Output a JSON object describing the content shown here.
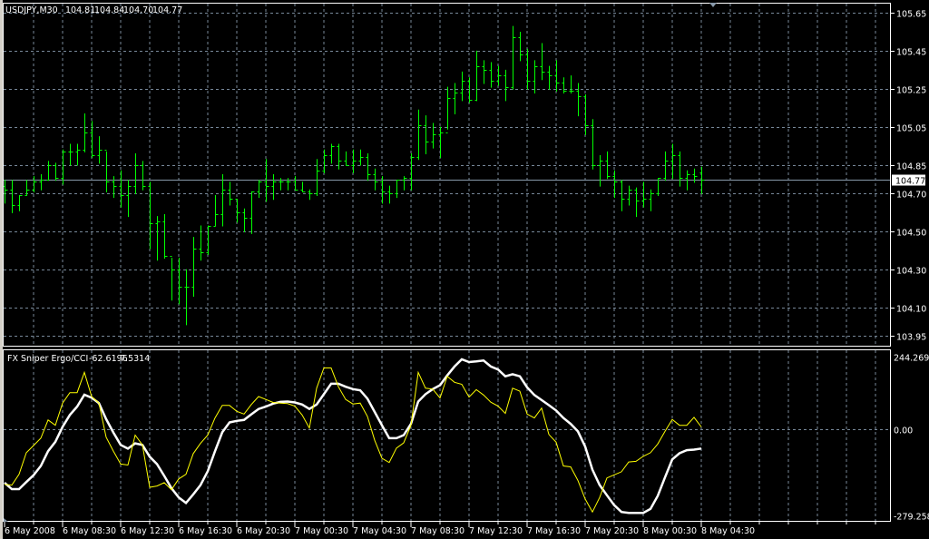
{
  "header": {
    "symbol": "USDJPY,M30",
    "open": "104.81",
    "high": "104.84",
    "low": "104.70",
    "close": "104.77"
  },
  "indicator": {
    "name": "FX Sniper Ergo/CCI",
    "value1": "-62.6196",
    "value2": "7.5314"
  },
  "colors": {
    "background": "#000000",
    "bars": "#00ff00",
    "grid": "#778899",
    "frame": "#ffffff",
    "ergo_line": "#ffffff",
    "cci_line": "#ffff00",
    "price_line": "#8899aa"
  },
  "price_axis": {
    "labels": [
      "105.65",
      "105.45",
      "105.25",
      "105.05",
      "104.85",
      "104.70",
      "104.50",
      "104.30",
      "104.10",
      "103.95"
    ],
    "current_price": "104.77"
  },
  "indicator_axis": {
    "labels": [
      "244.269",
      "0.00",
      "-279.258"
    ]
  },
  "time_axis": {
    "labels": [
      "6 May 2008",
      "6 May 08:30",
      "6 May 12:30",
      "6 May 16:30",
      "6 May 20:30",
      "7 May 00:30",
      "7 May 04:30",
      "7 May 08:30",
      "7 May 12:30",
      "7 May 16:30",
      "7 May 20:30",
      "8 May 00:30",
      "8 May 04:30"
    ]
  },
  "chart_data": [
    {
      "type": "ohlc",
      "symbol": "USDJPY",
      "timeframe": "M30",
      "ylim": [
        103.95,
        105.65
      ],
      "grid": true,
      "close": [
        104.72,
        104.64,
        104.69,
        104.72,
        104.76,
        104.77,
        104.85,
        104.78,
        104.92,
        104.92,
        104.93,
        105.02,
        104.9,
        104.93,
        104.76,
        104.74,
        104.69,
        104.74,
        104.85,
        104.74,
        104.54,
        104.55,
        104.37,
        104.3,
        104.21,
        104.21,
        104.41,
        104.39,
        104.53,
        104.59,
        104.72,
        104.67,
        104.6,
        104.57,
        104.71,
        104.76,
        104.74,
        104.76,
        104.76,
        104.76,
        104.72,
        104.71,
        104.7,
        104.82,
        104.9,
        104.95,
        104.87,
        104.85,
        104.87,
        104.89,
        104.8,
        104.76,
        104.71,
        104.7,
        104.77,
        104.78,
        104.89,
        105.06,
        104.97,
        105.01,
        105.02,
        105.2,
        105.23,
        105.29,
        105.19,
        105.37,
        105.35,
        105.29,
        105.32,
        105.26,
        105.52,
        105.43,
        105.29,
        105.37,
        105.34,
        105.32,
        105.28,
        105.24,
        105.24,
        105.21,
        105.06,
        104.85,
        104.87,
        104.79,
        104.76,
        104.67,
        104.72,
        104.66,
        104.67,
        104.7,
        104.78,
        104.87,
        104.9,
        104.78,
        104.8,
        104.79,
        104.77
      ],
      "high": [
        104.77,
        104.77,
        104.69,
        104.77,
        104.79,
        104.8,
        104.87,
        104.86,
        104.93,
        104.96,
        104.96,
        105.12,
        105.08,
        105.0,
        104.92,
        104.79,
        104.82,
        104.77,
        104.91,
        104.87,
        104.76,
        104.58,
        104.59,
        104.36,
        104.36,
        104.3,
        104.47,
        104.53,
        104.53,
        104.69,
        104.8,
        104.76,
        104.67,
        104.62,
        104.71,
        104.77,
        104.88,
        104.8,
        104.78,
        104.78,
        104.79,
        104.76,
        104.72,
        104.88,
        104.93,
        104.96,
        104.96,
        104.92,
        104.93,
        104.93,
        104.91,
        104.83,
        104.79,
        104.74,
        104.77,
        104.79,
        104.91,
        105.14,
        105.11,
        105.07,
        105.05,
        105.26,
        105.28,
        105.34,
        105.31,
        105.45,
        105.4,
        105.39,
        105.37,
        105.35,
        105.58,
        105.55,
        105.46,
        105.4,
        105.49,
        105.37,
        105.4,
        105.31,
        105.32,
        105.28,
        105.22,
        105.09,
        104.9,
        104.92,
        104.82,
        104.77,
        104.74,
        104.73,
        104.76,
        104.72,
        104.78,
        104.92,
        104.96,
        104.92,
        104.82,
        104.83,
        104.84
      ],
      "low": [
        104.65,
        104.6,
        104.61,
        104.69,
        104.71,
        104.72,
        104.77,
        104.77,
        104.75,
        104.85,
        104.85,
        104.92,
        104.89,
        104.86,
        104.71,
        104.68,
        104.63,
        104.58,
        104.7,
        104.72,
        104.41,
        104.35,
        104.36,
        104.14,
        104.12,
        104.01,
        104.16,
        104.35,
        104.38,
        104.53,
        104.53,
        104.64,
        104.55,
        104.5,
        104.49,
        104.68,
        104.66,
        104.67,
        104.72,
        104.72,
        104.72,
        104.71,
        104.67,
        104.69,
        104.81,
        104.86,
        104.83,
        104.85,
        104.81,
        104.85,
        104.77,
        104.72,
        104.65,
        104.65,
        104.68,
        104.72,
        104.72,
        104.88,
        104.91,
        104.94,
        104.89,
        105.04,
        105.12,
        105.19,
        105.18,
        105.19,
        105.28,
        105.26,
        105.27,
        105.19,
        105.25,
        105.4,
        105.25,
        105.23,
        105.3,
        105.25,
        105.24,
        105.23,
        105.23,
        105.11,
        105.01,
        104.83,
        104.74,
        104.78,
        104.68,
        104.61,
        104.64,
        104.58,
        104.63,
        104.61,
        104.69,
        104.77,
        104.78,
        104.74,
        104.72,
        104.76,
        104.7
      ],
      "last_open": 104.81
    },
    {
      "type": "line",
      "title": "FX Sniper Ergo/CCI",
      "ylim": [
        -279.258,
        244.269
      ],
      "grid": true,
      "series": [
        {
          "color": "#ffffff",
          "values": [
            -173,
            -194,
            -194,
            -171,
            -149,
            -119,
            -71,
            -41,
            8,
            48,
            76,
            116,
            106,
            88,
            34,
            -11,
            -51,
            -63,
            -46,
            -51,
            -89,
            -113,
            -151,
            -191,
            -221,
            -239,
            -211,
            -181,
            -136,
            -71,
            -10,
            23,
            28,
            31,
            50,
            68,
            76,
            86,
            92,
            93,
            90,
            83,
            68,
            83,
            118,
            153,
            153,
            143,
            135,
            131,
            103,
            58,
            13,
            -29,
            -29,
            -19,
            18,
            93,
            118,
            135,
            148,
            181,
            211,
            235,
            226,
            228,
            231,
            211,
            201,
            178,
            185,
            178,
            141,
            115,
            98,
            81,
            63,
            38,
            18,
            -7,
            -56,
            -131,
            -181,
            -214,
            -246,
            -268,
            -271,
            -271,
            -271,
            -258,
            -216,
            -156,
            -98,
            -78,
            -68,
            -66,
            -62.6196
          ]
        },
        {
          "color": "#ffff00",
          "values": [
            -179,
            -181,
            -146,
            -76,
            -53,
            -29,
            31,
            13,
            88,
            123,
            123,
            191,
            110,
            88,
            -26,
            -71,
            -113,
            -116,
            -19,
            -51,
            -188,
            -184,
            -173,
            -196,
            -161,
            -146,
            -79,
            -46,
            -19,
            38,
            80,
            80,
            60,
            51,
            83,
            110,
            100,
            90,
            88,
            86,
            78,
            48,
            4,
            138,
            206,
            206,
            143,
            100,
            85,
            88,
            43,
            -36,
            -94,
            -108,
            -61,
            -44,
            13,
            191,
            138,
            135,
            105,
            178,
            158,
            151,
            108,
            133,
            115,
            91,
            78,
            53,
            138,
            128,
            51,
            38,
            71,
            -17,
            -42,
            -119,
            -122,
            -166,
            -226,
            -268,
            -221,
            -158,
            -148,
            -138,
            -106,
            -104,
            -88,
            -76,
            -48,
            -7,
            33,
            13,
            13,
            40,
            7.5314
          ]
        }
      ]
    }
  ]
}
